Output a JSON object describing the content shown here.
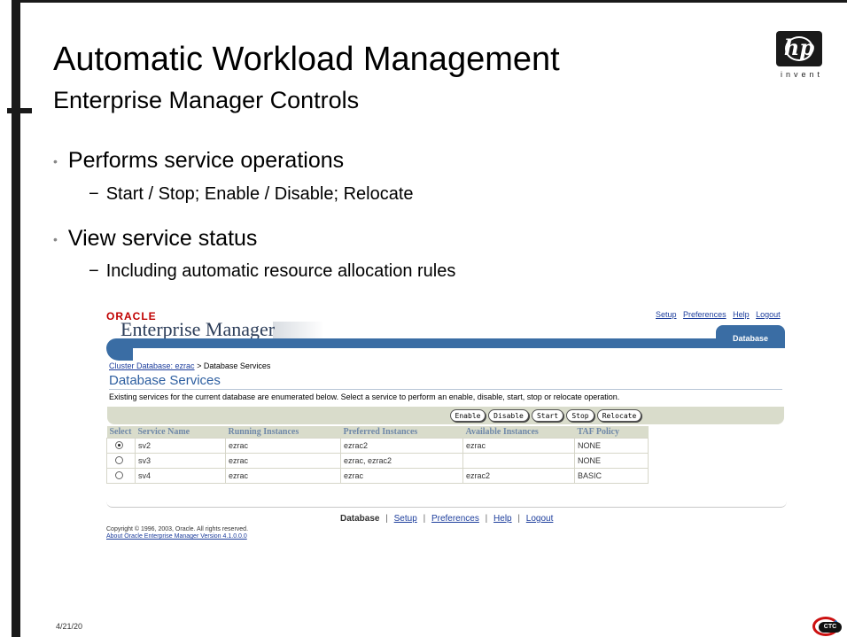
{
  "slide": {
    "title": "Automatic Workload Management",
    "subtitle": "Enterprise Manager Controls",
    "logo": {
      "mark": "hp",
      "tagline": "invent"
    },
    "bullets": [
      {
        "text": "Performs service operations",
        "sub": "Start / Stop; Enable / Disable; Relocate"
      },
      {
        "text": "View service status",
        "sub": "Including automatic resource allocation rules"
      }
    ],
    "bullet_glyph": "•",
    "sub_glyph": "−",
    "date": "4/21/20",
    "ctc_logo": "CTC"
  },
  "em": {
    "brand": "ORACLE",
    "app_title": "Enterprise Manager",
    "top_links": [
      "Setup",
      "Preferences",
      "Help",
      "Logout"
    ],
    "tab": "Database",
    "breadcrumb": {
      "link": "Cluster Database: ezrac",
      "separator": ">",
      "current": "Database Services"
    },
    "page_heading": "Database Services",
    "description": "Existing services for the current database are enumerated below. Select a service to perform an enable, disable, start, stop or relocate operation.",
    "actions": [
      "Enable",
      "Disable",
      "Start",
      "Stop",
      "Relocate"
    ],
    "table": {
      "headers": [
        "Select",
        "Service Name",
        "Running Instances",
        "Preferred Instances",
        "Available Instances",
        "TAF Policy"
      ],
      "rows": [
        {
          "selected": true,
          "service": "sv2",
          "running": "ezrac",
          "preferred": "ezrac2",
          "available": "ezrac",
          "taf": "NONE"
        },
        {
          "selected": false,
          "service": "sv3",
          "running": "ezrac",
          "preferred": "ezrac, ezrac2",
          "available": "",
          "taf": "NONE"
        },
        {
          "selected": false,
          "service": "sv4",
          "running": "ezrac",
          "preferred": "ezrac",
          "available": "ezrac2",
          "taf": "BASIC"
        }
      ]
    },
    "footer_links": {
      "current": "Database",
      "links": [
        "Setup",
        "Preferences",
        "Help",
        "Logout"
      ],
      "separator": "|"
    },
    "copyright": "Copyright © 1996, 2003, Oracle. All rights reserved.",
    "about": "About Oracle Enterprise Manager Version 4.1.0.0.0"
  },
  "colors": {
    "accent_blue": "#3a6da4",
    "oracle_red": "#c00000",
    "header_bg": "#d9dccb",
    "link": "#1c3d9c"
  }
}
